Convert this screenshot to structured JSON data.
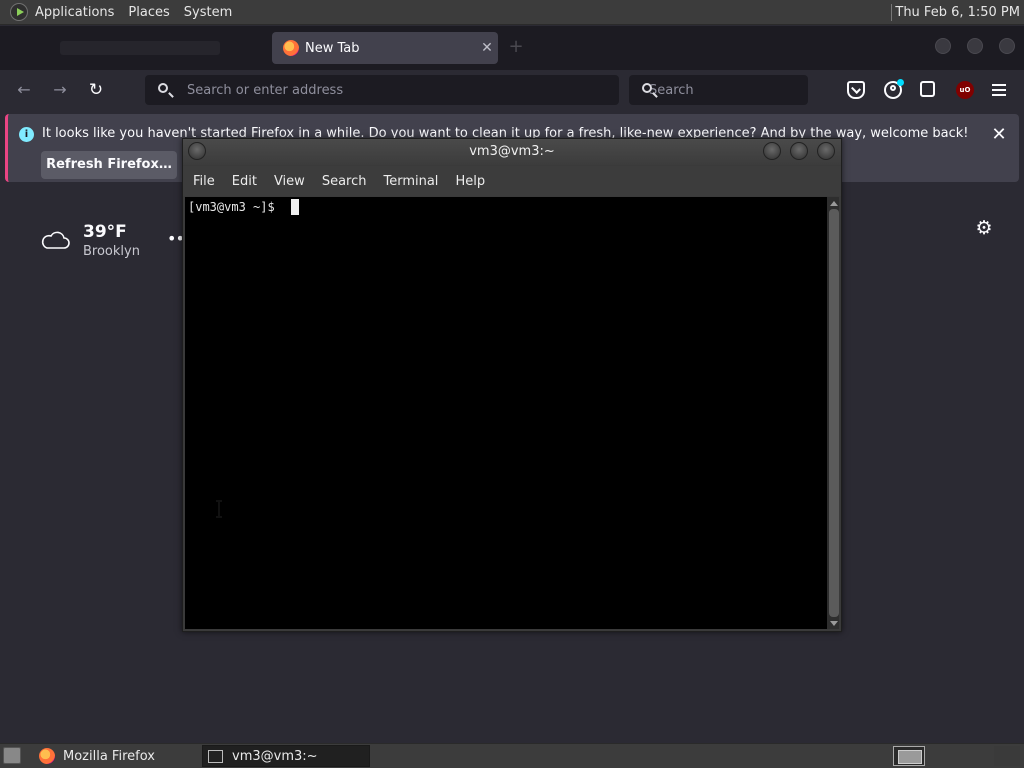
{
  "top_panel": {
    "menus": [
      "Applications",
      "Places",
      "System"
    ],
    "clock": "Thu Feb  6,  1:50 PM"
  },
  "firefox": {
    "tabs": [
      {
        "label": "",
        "active": false
      },
      {
        "label": "New Tab",
        "active": true
      }
    ],
    "urlbar": {
      "placeholder": "Search or enter address"
    },
    "searchbar": {
      "placeholder": "Search"
    },
    "notification": {
      "text": "It looks like you haven't started Firefox in a while. Do you want to clean it up for a fresh, like-new experience? And by the way, welcome back!",
      "button_label": "Refresh Firefox…"
    },
    "weather": {
      "temperature": "39°F",
      "city": "Brooklyn",
      "icon": "cloud-icon"
    }
  },
  "terminal": {
    "title": "vm3@vm3:~",
    "menus": [
      "File",
      "Edit",
      "View",
      "Search",
      "Terminal",
      "Help"
    ],
    "prompt": "[vm3@vm3 ~]$ "
  },
  "taskbar": {
    "items": [
      {
        "label": "Mozilla Firefox",
        "icon": "firefox-icon",
        "active": false
      },
      {
        "label": "vm3@vm3:~",
        "icon": "terminal-icon",
        "active": true
      }
    ]
  },
  "colors": {
    "firefox_bg": "#2b2a33",
    "notification_bg": "#42414d",
    "notification_accent": "#e94584",
    "terminal_bg": "#000000",
    "panel_bg": "#3c3c3c"
  }
}
